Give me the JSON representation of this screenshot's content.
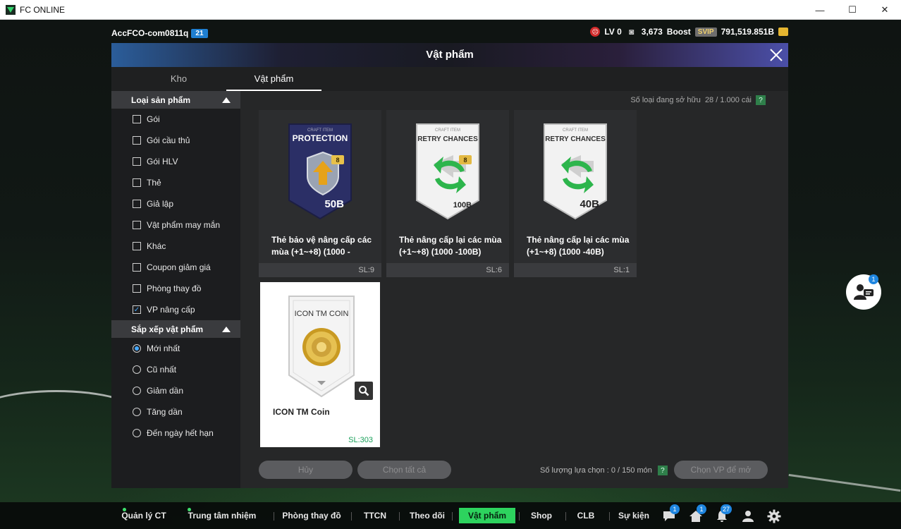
{
  "window": {
    "title": "FC ONLINE",
    "controls": [
      "—",
      "☐",
      "✕"
    ]
  },
  "account": {
    "name": "AccFCO-com0811q",
    "badge": "21"
  },
  "stats": {
    "level": "LV 0",
    "mk_value": "3,673",
    "boost_label": "Boost",
    "svip": "SVIP",
    "coins": "791,519.851B"
  },
  "modal": {
    "title": "Vật phẩm",
    "tabs": [
      {
        "label": "Kho"
      },
      {
        "label": "Vật phẩm"
      }
    ],
    "active_tab": 1,
    "owned_label": "Số loại đang sở hữu",
    "owned_value": "28 / 1.000 cái",
    "help": "?"
  },
  "sidebar": {
    "type_header": "Loại sản phẩm",
    "types": [
      {
        "label": "Gói",
        "checked": false
      },
      {
        "label": "Gói cầu thủ",
        "checked": false
      },
      {
        "label": "Gói HLV",
        "checked": false
      },
      {
        "label": "Thẻ",
        "checked": false
      },
      {
        "label": "Giả lập",
        "checked": false
      },
      {
        "label": "Vật phẩm may mắn",
        "checked": false
      },
      {
        "label": "Khác",
        "checked": false
      },
      {
        "label": "Coupon giảm giá",
        "checked": false
      },
      {
        "label": "Phòng thay đồ",
        "checked": false
      },
      {
        "label": "VP nâng cấp",
        "checked": true
      }
    ],
    "sort_header": "Sắp xếp vật phẩm",
    "sorts": [
      {
        "label": "Mới nhất",
        "selected": true
      },
      {
        "label": "Cũ nhất",
        "selected": false
      },
      {
        "label": "Giảm dần",
        "selected": false
      },
      {
        "label": "Tăng dần",
        "selected": false
      },
      {
        "label": "Đến ngày hết hạn",
        "selected": false
      }
    ]
  },
  "items": [
    {
      "name": "Thẻ bảo vệ nâng cấp các mùa (+1~+8) (1000 -",
      "qty": "SL:9",
      "art_small": "CRAFT ITEM",
      "art_title": "PROTECTION",
      "art_value": "50B",
      "art_badge": "8",
      "style": "dark"
    },
    {
      "name": "Thẻ nâng cấp lại các mùa (+1~+8) (1000 -100B)",
      "qty": "SL:6",
      "art_small": "CRAFT ITEM",
      "art_title": "RETRY CHANCES",
      "art_value": "100B",
      "art_badge": "8",
      "style": "light"
    },
    {
      "name": "Thẻ nâng cấp lại các mùa (+1~+8) (1000 -40B)",
      "qty": "SL:1",
      "art_small": "CRAFT ITEM",
      "art_title": "RETRY CHANCES",
      "art_value": "40B",
      "art_badge": "",
      "style": "light"
    },
    {
      "name": "ICON TM Coin",
      "qty": "SL:303",
      "art_small": "",
      "art_title": "ICON TM COIN",
      "art_value": "",
      "art_badge": "",
      "style": "coin"
    }
  ],
  "footer": {
    "cancel": "Hủy",
    "select_all": "Chọn tất cả",
    "selected_label": "Số lượng lựa chọn : 0 / 150 món",
    "help": "?",
    "choose_open": "Chọn VP để mở"
  },
  "chat_badge": "1",
  "nav": {
    "items": [
      {
        "label": "Quản lý CT",
        "dot": true
      },
      {
        "label": "Trung tâm nhiệm vụ",
        "dot": true
      },
      {
        "label": "Phòng thay đồ",
        "dot": false
      },
      {
        "label": "TTCN",
        "dot": false
      },
      {
        "label": "Theo dõi",
        "dot": false
      },
      {
        "label": "Vật phẩm",
        "dot": false
      },
      {
        "label": "Shop",
        "dot": false
      },
      {
        "label": "CLB",
        "dot": false
      },
      {
        "label": "Sự kiện",
        "dot": false
      }
    ],
    "active": 5,
    "icon_badges": {
      "chat": "1",
      "home": "1",
      "bell": "27"
    }
  },
  "colors": {
    "accent_green": "#2dd35e",
    "selected_blue": "#46a9ff",
    "badge_blue": "#1f86e0"
  }
}
